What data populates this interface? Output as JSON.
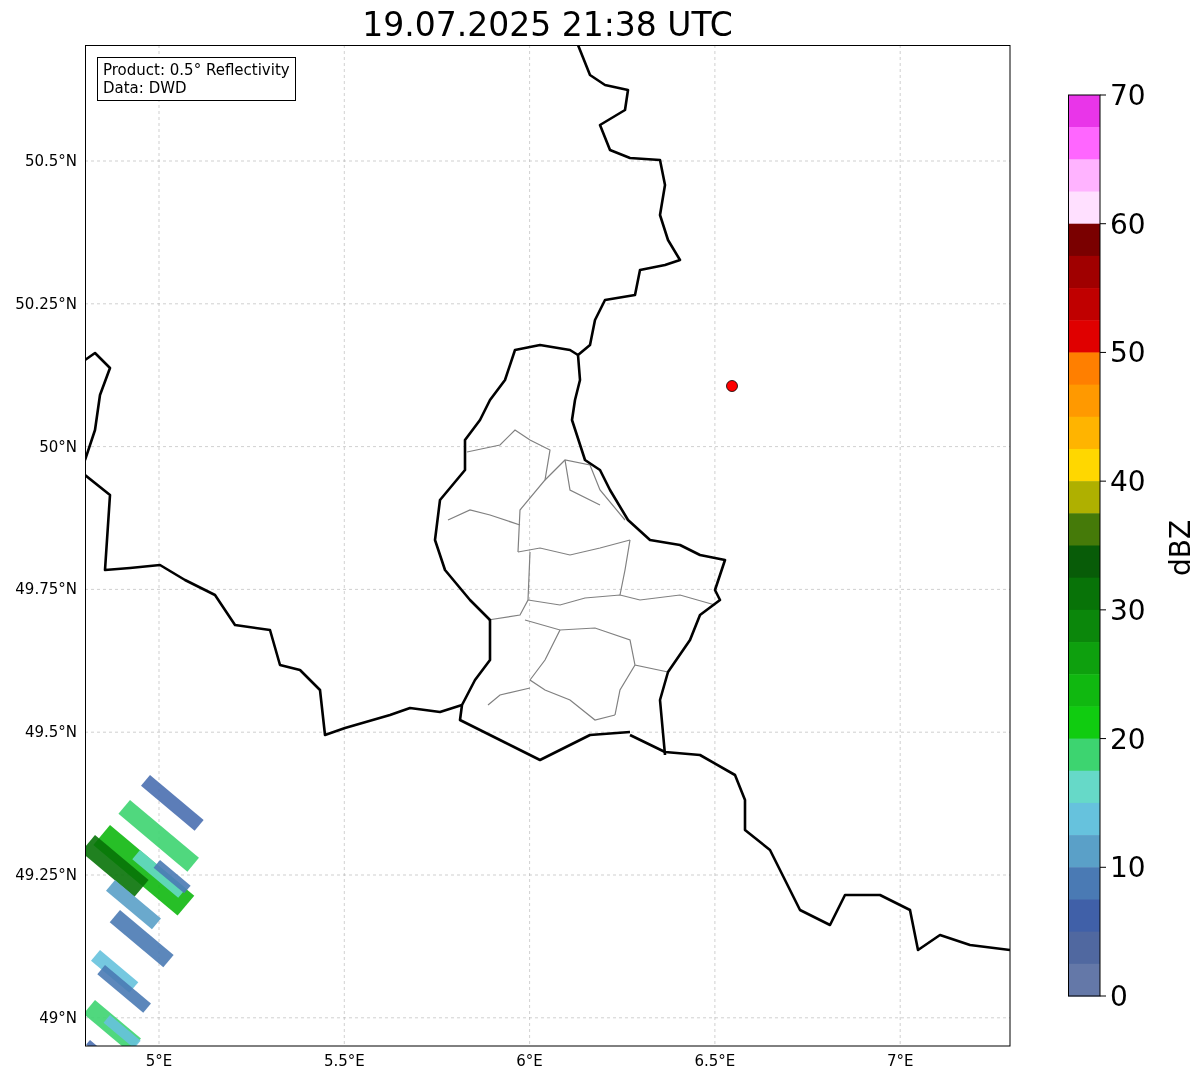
{
  "title": "19.07.2025 21:38 UTC",
  "info_box": {
    "lines": [
      "Product: 0.5° Reflectivity",
      "Data: DWD"
    ]
  },
  "x_ticks": [
    "5°E",
    "5.5°E",
    "6°E",
    "6.5°E",
    "7°E"
  ],
  "y_ticks": [
    "50.5°N",
    "50.25°N",
    "50°N",
    "49.75°N",
    "49.5°N",
    "49.25°N",
    "49°N"
  ],
  "colorbar": {
    "label": "dBZ",
    "ticks": [
      "70",
      "60",
      "50",
      "40",
      "30",
      "20",
      "10",
      "0"
    ],
    "bins": [
      {
        "color": "#e935e9"
      },
      {
        "color": "#ff66ff"
      },
      {
        "color": "#ffb3ff"
      },
      {
        "color": "#ffe0ff"
      },
      {
        "color": "#7a0000"
      },
      {
        "color": "#a00000"
      },
      {
        "color": "#c00000"
      },
      {
        "color": "#e00000"
      },
      {
        "color": "#ff7f00"
      },
      {
        "color": "#ff9900"
      },
      {
        "color": "#ffb400"
      },
      {
        "color": "#ffd700"
      },
      {
        "color": "#afb000"
      },
      {
        "color": "#457a09"
      },
      {
        "color": "#085c08"
      },
      {
        "color": "#087308"
      },
      {
        "color": "#0b870b"
      },
      {
        "color": "#0ea00e"
      },
      {
        "color": "#10b810"
      },
      {
        "color": "#10cc10"
      },
      {
        "color": "#3dd470"
      },
      {
        "color": "#66d9c8"
      },
      {
        "color": "#66c2dd"
      },
      {
        "color": "#5aa0c8"
      },
      {
        "color": "#4a7ab4"
      },
      {
        "color": "#4060a8"
      },
      {
        "color": "#5068a0"
      },
      {
        "color": "#6478a8"
      }
    ]
  }
}
